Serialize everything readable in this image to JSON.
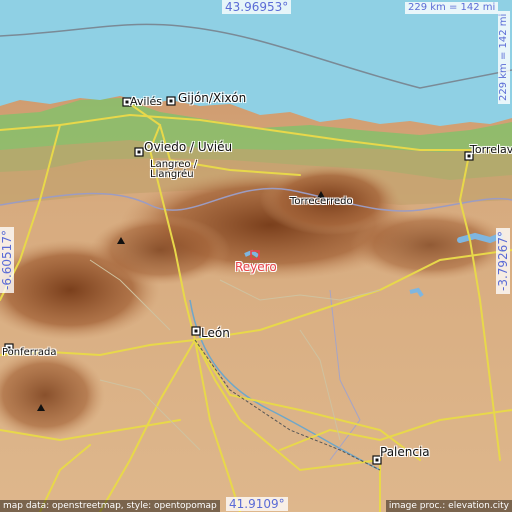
{
  "coordinates": {
    "top_lat": "43.96953°",
    "bottom_lat": "41.9109°",
    "left_lon": "-6.60517°",
    "right_lon": "-3.79267°"
  },
  "scale": {
    "horizontal": "229 km = 142 mi",
    "vertical": "229 km = 142 mi"
  },
  "places": {
    "aviles": "Avilés",
    "gijon": "Gijón/Xixón",
    "oviedo": "Oviedo / Uviéu",
    "langreo": "Langreo /\nLlangréu",
    "torrelavega": "Torrelaveg",
    "torrecerredo": "Torrecerredo",
    "reyero": "Reyero",
    "leon": "León",
    "ponferrada": "Ponferrada",
    "palencia": "Palencia"
  },
  "credits": {
    "left": "map data: openstreetmap, style: opentopomap",
    "right": "image proc.: elevation.city"
  },
  "colors": {
    "sea": "#8fd0e4",
    "lowland_green": "#7bbf6a",
    "terrain_tan": "#d8ad7e",
    "mountain_brown": "#9a5a30",
    "road_yellow": "#e8d84a",
    "target_red": "#e8434a",
    "coord_blue": "#5b6cd6"
  },
  "icons": [
    "city-square-icon",
    "peak-triangle-icon",
    "target-square-icon"
  ]
}
